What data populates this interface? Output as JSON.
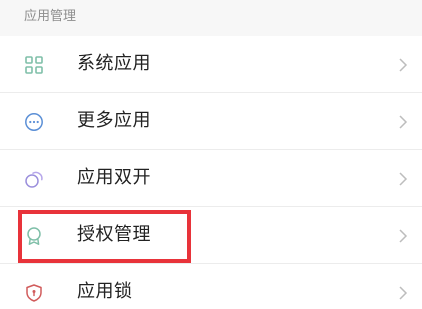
{
  "section": {
    "title": "应用管理"
  },
  "items": [
    {
      "label": "系统应用",
      "icon": "grid-icon"
    },
    {
      "label": "更多应用",
      "icon": "more-icon"
    },
    {
      "label": "应用双开",
      "icon": "dual-circle-icon"
    },
    {
      "label": "授权管理",
      "icon": "badge-icon"
    },
    {
      "label": "应用锁",
      "icon": "shield-lock-icon"
    }
  ],
  "colors": {
    "text": "#222222",
    "section_title": "#8d8d8d",
    "icon_green": "#7fbfa8",
    "icon_blue": "#5b8fd6",
    "icon_purple": "#9b8fdc",
    "icon_red": "#d15b5b",
    "chevron": "#bdbdbd",
    "highlight": "#e8333a"
  }
}
